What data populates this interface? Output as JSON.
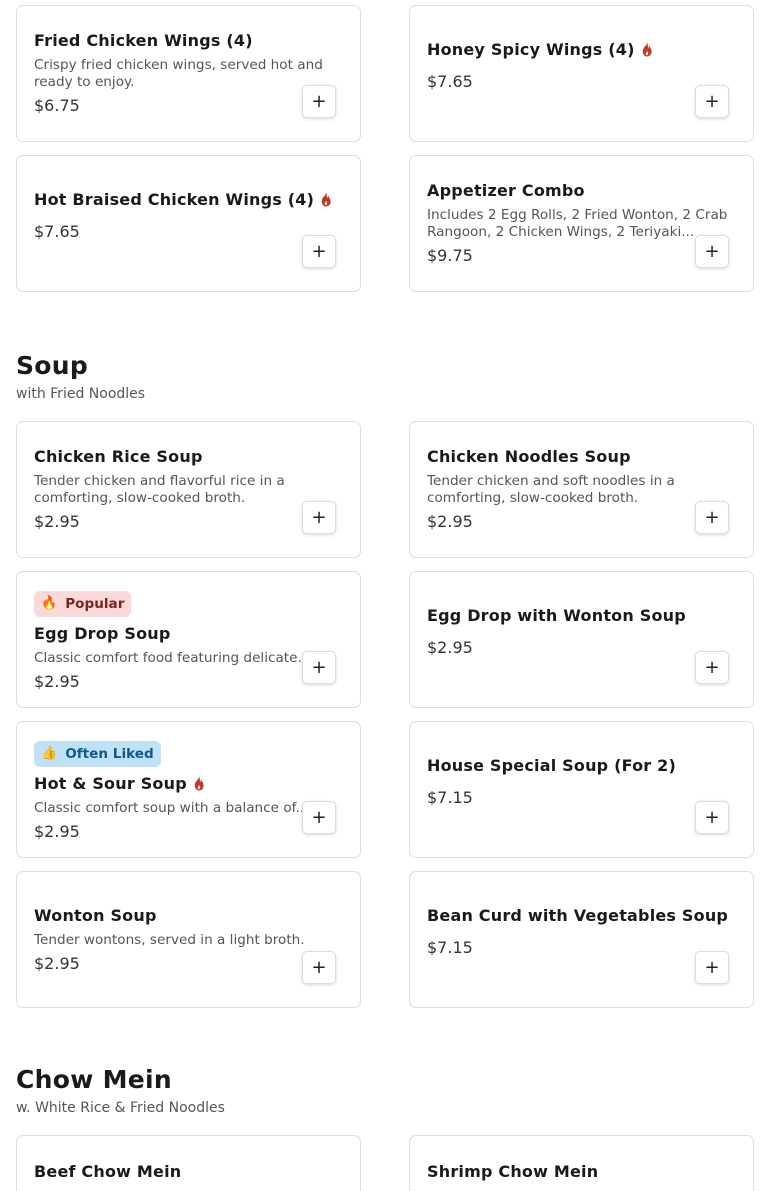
{
  "appetizers": {
    "items": [
      {
        "name": "Fried Chicken Wings (4)",
        "desc": "Crispy fried chicken wings, served hot and ready to enjoy.",
        "price": "$6.75",
        "add": "+"
      },
      {
        "name": "Honey Spicy Wings (4)",
        "price": "$7.65",
        "add": "+",
        "spicy": true
      },
      {
        "name": "Hot Braised Chicken Wings (4)",
        "price": "$7.65",
        "add": "+",
        "spicy": true
      },
      {
        "name": "Appetizer Combo",
        "desc": "Includes 2 Egg Rolls, 2 Fried Wonton, 2 Crab Rangoon, 2 Chicken Wings, 2 Teriyaki...",
        "price": "$9.75",
        "add": "+"
      }
    ]
  },
  "soup": {
    "title": "Soup",
    "subtitle": "with Fried Noodles",
    "items": [
      {
        "name": "Chicken Rice Soup",
        "desc": "Tender chicken and flavorful rice in a comforting, slow-cooked broth.",
        "price": "$2.95",
        "add": "+"
      },
      {
        "name": "Chicken Noodles Soup",
        "desc": "Tender chicken and soft noodles in a comforting, slow-cooked broth.",
        "price": "$2.95",
        "add": "+"
      },
      {
        "name": "Egg Drop Soup",
        "badge": "Popular",
        "badge_icon": "fire-icon",
        "desc": "Classic comfort food featuring delicate...",
        "price": "$2.95",
        "add": "+"
      },
      {
        "name": "Egg Drop with Wonton Soup",
        "price": "$2.95",
        "add": "+"
      },
      {
        "name": "Hot & Sour Soup",
        "badge": "Often Liked",
        "badge_icon": "thumbs-up-icon",
        "desc": "Classic comfort soup with a balance of...",
        "price": "$2.95",
        "add": "+",
        "spicy": true
      },
      {
        "name": "House Special Soup (For 2)",
        "price": "$7.15",
        "add": "+"
      },
      {
        "name": "Wonton Soup",
        "desc": "Tender wontons, served in a light broth.",
        "price": "$2.95",
        "add": "+"
      },
      {
        "name": "Bean Curd with Vegetables Soup",
        "price": "$7.15",
        "add": "+"
      }
    ]
  },
  "chow_mein": {
    "title": "Chow Mein",
    "subtitle": "w. White Rice & Fried Noodles",
    "items": [
      {
        "name": "Beef Chow Mein"
      },
      {
        "name": "Shrimp Chow Mein"
      }
    ]
  },
  "colors": {
    "flame": "#c0392b",
    "popular_bg": "#fbd9d9",
    "liked_bg": "#bfe2f7"
  },
  "icons": {
    "spicy": "flame-icon",
    "add": "plus-icon"
  }
}
